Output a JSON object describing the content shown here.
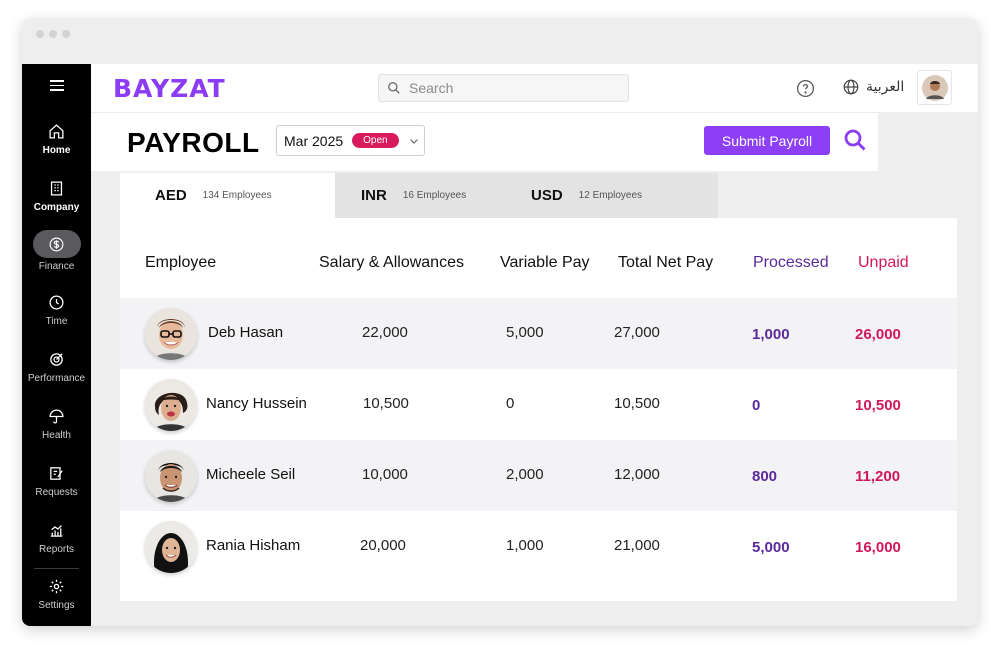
{
  "app": {
    "logo": "BAYZAT",
    "search_placeholder": "Search",
    "language": "العربية"
  },
  "sidebar": {
    "items": [
      {
        "label": "Home",
        "icon": "home-icon"
      },
      {
        "label": "Company",
        "icon": "building-icon"
      },
      {
        "label": "Finance",
        "icon": "dollar-icon"
      },
      {
        "label": "Time",
        "icon": "clock-icon"
      },
      {
        "label": "Performance",
        "icon": "target-icon"
      },
      {
        "label": "Health",
        "icon": "umbrella-icon"
      },
      {
        "label": "Requests",
        "icon": "edit-icon"
      },
      {
        "label": "Reports",
        "icon": "chart-icon"
      },
      {
        "label": "Settings",
        "icon": "gear-icon"
      }
    ]
  },
  "header": {
    "title": "PAYROLL",
    "period": "Mar 2025",
    "status": "Open",
    "submit_label": "Submit Payroll"
  },
  "tabs": [
    {
      "currency": "AED",
      "count": "134 Employees"
    },
    {
      "currency": "INR",
      "count": "16 Employees"
    },
    {
      "currency": "USD",
      "count": "12 Employees"
    }
  ],
  "table": {
    "columns": [
      "Employee",
      "Salary & Allowances",
      "Variable Pay",
      "Total Net Pay",
      "Processed",
      "Unpaid"
    ],
    "rows": [
      {
        "name": "Deb Hasan",
        "salary": "22,000",
        "variable": "5,000",
        "total": "27,000",
        "processed": "1,000",
        "unpaid": "26,000"
      },
      {
        "name": "Nancy Hussein",
        "salary": "10,500",
        "variable": "0",
        "total": "10,500",
        "processed": "0",
        "unpaid": "10,500"
      },
      {
        "name": "Micheele Seil",
        "salary": "10,000",
        "variable": "2,000",
        "total": "12,000",
        "processed": "800",
        "unpaid": "11,200"
      },
      {
        "name": "Rania Hisham",
        "salary": "20,000",
        "variable": "1,000",
        "total": "21,000",
        "processed": "5,000",
        "unpaid": "16,000"
      }
    ]
  },
  "colors": {
    "brand": "#8b3cf4",
    "processed": "#5b2a9a",
    "unpaid": "#d1175a",
    "badge": "#d91a5c"
  }
}
